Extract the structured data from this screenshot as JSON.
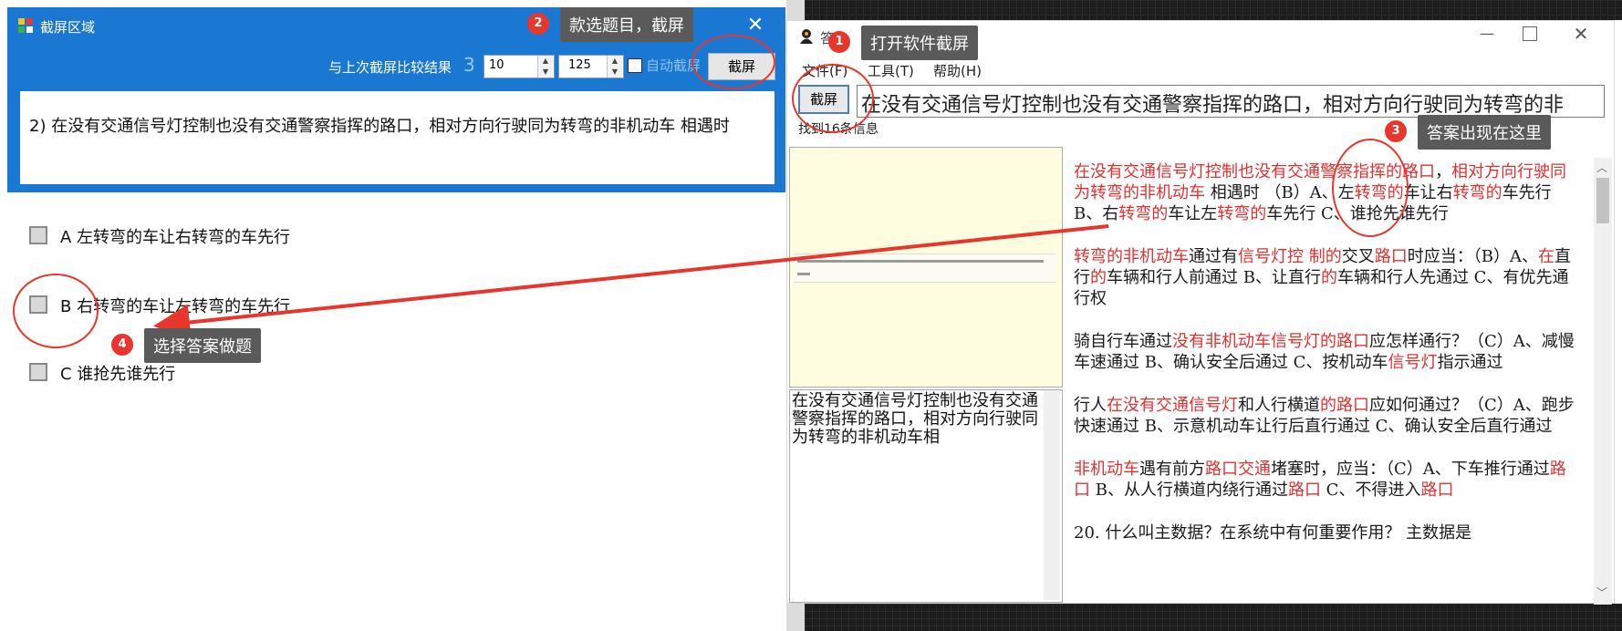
{
  "left_window": {
    "title": "截屏区域",
    "compare_label": "与上次截屏比较结果",
    "compare_value": "3",
    "input1_value": "10",
    "input2_value": "125",
    "auto_capture_label": "自动截屏",
    "capture_button": "截屏",
    "question": "2) 在没有交通信号灯控制也没有交通警察指挥的路口，相对方向行驶同为转弯的非机动车 相遇时",
    "options": [
      {
        "label": "A 左转弯的车让右转弯的车先行"
      },
      {
        "label": "B 右转弯的车让左转弯的车先行"
      },
      {
        "label": "C 谁抢先谁先行"
      }
    ]
  },
  "right_window": {
    "title_partial": "答",
    "menu": {
      "file": "文件(F)",
      "tools": "工具(T)",
      "help": "帮助(H)"
    },
    "capture_button": "截屏",
    "search_value": "在没有交通信号灯控制也没有交通警察指挥的路口，相对方向行驶同为转弯的非",
    "found_label": "找到16条信息",
    "ocr_text": "在没有交通信号灯控制也没有交通警察指挥的路口，相对方向行驶同为转弯的非机动车相",
    "answers": [
      {
        "segments": [
          {
            "t": "在没有交通信号灯控制也没有交通警察指挥的路口",
            "red": true
          },
          {
            "t": "，",
            "red": false
          },
          {
            "t": "相对方向行驶同为转弯的非机动车",
            "red": true
          },
          {
            "t": " 相遇时 （B）A、左",
            "red": false
          },
          {
            "t": "转弯的",
            "red": true
          },
          {
            "t": "车让右",
            "red": false
          },
          {
            "t": "转弯的",
            "red": true
          },
          {
            "t": "车先行 B、右",
            "red": false
          },
          {
            "t": "转弯的",
            "red": true
          },
          {
            "t": "车让左",
            "red": false
          },
          {
            "t": "转弯的",
            "red": true
          },
          {
            "t": "车先行 C、谁抢先谁先行",
            "red": false
          }
        ]
      },
      {
        "segments": [
          {
            "t": "转弯的非机动车",
            "red": true
          },
          {
            "t": "通过有",
            "red": false
          },
          {
            "t": "信号灯控 制的",
            "red": true
          },
          {
            "t": "交叉",
            "red": false
          },
          {
            "t": "路口",
            "red": true
          },
          {
            "t": "时应当：（B）A、",
            "red": false
          },
          {
            "t": "在",
            "red": true
          },
          {
            "t": "直行",
            "red": false
          },
          {
            "t": "的",
            "red": true
          },
          {
            "t": "车辆和行人前通过 B、让直行",
            "red": false
          },
          {
            "t": "的",
            "red": true
          },
          {
            "t": "车辆和行人先通过 C、有优先通行权",
            "red": false
          }
        ]
      },
      {
        "segments": [
          {
            "t": "骑自行车通过",
            "red": false
          },
          {
            "t": "没有非机动车信号灯的路口",
            "red": true
          },
          {
            "t": "应怎样通行？（C）A、减慢车速通过 B、确认安全后通过 C、按机动车",
            "red": false
          },
          {
            "t": "信号灯",
            "red": true
          },
          {
            "t": "指示通过",
            "red": false
          }
        ]
      },
      {
        "segments": [
          {
            "t": "行人",
            "red": false
          },
          {
            "t": "在没有交通信号灯",
            "red": true
          },
          {
            "t": "和人行横道",
            "red": false
          },
          {
            "t": "的路口",
            "red": true
          },
          {
            "t": "应如何通过？（C）A、跑步快速通过 B、示意机动车让行后直行通过 C、确认安全后直行通过",
            "red": false
          }
        ]
      },
      {
        "segments": [
          {
            "t": "非机动车",
            "red": true
          },
          {
            "t": "遇有前方",
            "red": false
          },
          {
            "t": "路口交通",
            "red": true
          },
          {
            "t": "堵塞时，应当：（C）A、下车推行通过",
            "red": false
          },
          {
            "t": "路口",
            "red": true
          },
          {
            "t": " B、从人行横道内绕行通过",
            "red": false
          },
          {
            "t": "路口",
            "red": true
          },
          {
            "t": " C、不得进入",
            "red": false
          },
          {
            "t": "路口",
            "red": true
          }
        ]
      }
    ],
    "cut_line": "20. 什么叫主数据？在系统中有何重要作用？ 主数据是"
  },
  "callouts": [
    {
      "num": "1",
      "text": "打开软件截屏"
    },
    {
      "num": "2",
      "text": "款选题目，截屏"
    },
    {
      "num": "3",
      "text": "答案出现在这里"
    },
    {
      "num": "4",
      "text": "选择答案做题"
    }
  ],
  "colors": {
    "title_blue": "#1a78d2",
    "accent_red": "#e8362c",
    "callout_gray": "#5a5a5a",
    "preview_yellow": "#fffde0"
  }
}
